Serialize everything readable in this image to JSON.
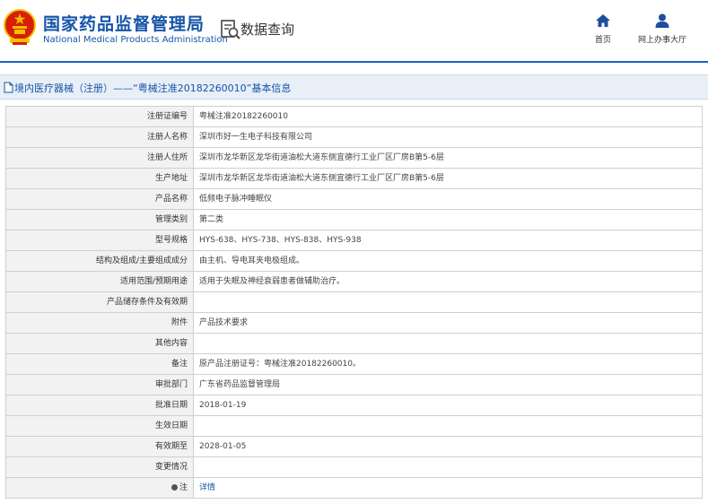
{
  "header": {
    "brand_cn": "国家药品监督管理局",
    "brand_en": "National Medical Products Administration",
    "query_title": "数据查询",
    "nav": {
      "home": "首页",
      "office": "网上办事大厅"
    }
  },
  "breadcrumb": "境内医疗器械（注册）——“粤械注准20182260010”基本信息",
  "colors": {
    "brand_blue": "#1554a8",
    "accent_line": "#1b63c2",
    "emblem_red": "#d81e06",
    "emblem_gold": "#f6c200"
  },
  "table": {
    "rows": [
      {
        "label": "注册证编号",
        "value": "粤械注准20182260010"
      },
      {
        "label": "注册人名称",
        "value": "深圳市好一生电子科技有限公司"
      },
      {
        "label": "注册人住所",
        "value": "深圳市龙华新区龙华街道油松大道东侧宜德行工业厂区厂房B第5-6层"
      },
      {
        "label": "生产地址",
        "value": "深圳市龙华新区龙华街道油松大道东侧宜德行工业厂区厂房B第5-6层"
      },
      {
        "label": "产品名称",
        "value": "低频电子脉冲睡眠仪"
      },
      {
        "label": "管理类别",
        "value": "第二类"
      },
      {
        "label": "型号规格",
        "value": "HYS-638、HYS-738、HYS-838、HYS-938"
      },
      {
        "label": "结构及组成/主要组成成分",
        "value": "由主机、导电耳夹电极组成。"
      },
      {
        "label": "适用范围/预期用途",
        "value": "适用于失眠及神经衰弱患者做辅助治疗。"
      },
      {
        "label": "产品储存条件及有效期",
        "value": ""
      },
      {
        "label": "附件",
        "value": "产品技术要求"
      },
      {
        "label": "其他内容",
        "value": ""
      },
      {
        "label": "备注",
        "value": "原产品注册证号：粤械注准20182260010。"
      },
      {
        "label": "审批部门",
        "value": "广东省药品监督管理局"
      },
      {
        "label": "批准日期",
        "value": "2018-01-19"
      },
      {
        "label": "生效日期",
        "value": ""
      },
      {
        "label": "有效期至",
        "value": "2028-01-05"
      },
      {
        "label": "变更情况",
        "value": ""
      }
    ],
    "note": {
      "label": "注",
      "link": "详情"
    }
  }
}
